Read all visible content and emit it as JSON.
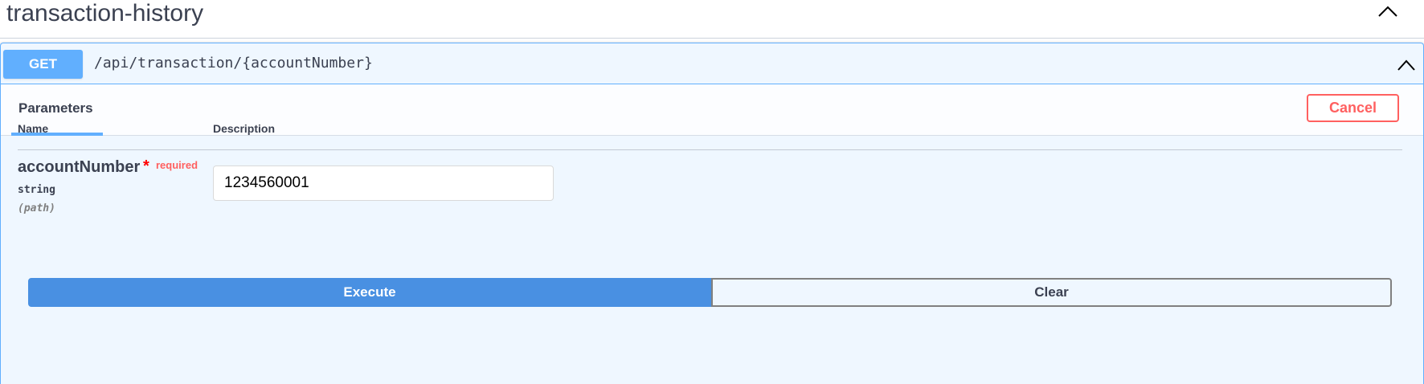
{
  "section": {
    "title": "transaction-history",
    "toggle_icon": "chevron-up-icon"
  },
  "operation": {
    "method": "GET",
    "path": "/api/transaction/{accountNumber}",
    "toggle_icon": "chevron-up-icon",
    "method_color": "#61affe"
  },
  "tabs": {
    "active": "Parameters"
  },
  "actions": {
    "cancel_label": "Cancel"
  },
  "parameters": {
    "headers": {
      "name": "Name",
      "description": "Description"
    },
    "items": [
      {
        "name": "accountNumber",
        "required_star": "*",
        "required_label": "required",
        "type": "string",
        "location": "(path)",
        "value": "1234560001"
      }
    ]
  },
  "buttons": {
    "execute": "Execute",
    "clear": "Clear",
    "execute_color": "#4990e2",
    "cancel_color": "#ff6060"
  }
}
